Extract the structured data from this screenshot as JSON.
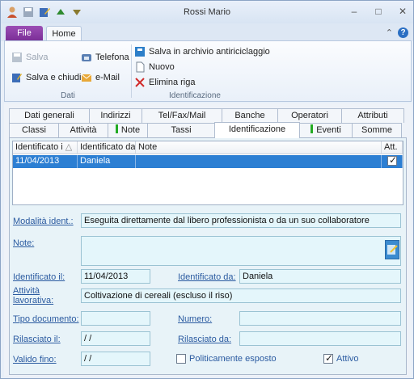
{
  "window": {
    "title": "Rossi Mario"
  },
  "ribbon_tabs": {
    "file": "File",
    "home": "Home"
  },
  "ribbon": {
    "dati": {
      "salva": "Salva",
      "salva_chiudi": "Salva e chiudi",
      "telefona": "Telefona",
      "email": "e-Mail",
      "label": "Dati"
    },
    "identificazione": {
      "salva_archivio": "Salva in archivio antiriciclaggio",
      "nuovo": "Nuovo",
      "elimina": "Elimina riga",
      "label": "Identificazione"
    }
  },
  "tabs": {
    "row1": [
      "Dati generali",
      "Indirizzi",
      "Tel/Fax/Mail",
      "Banche",
      "Operatori",
      "Attributi"
    ],
    "row2": [
      "Classi",
      "Attività",
      "Note",
      "Tassi",
      "Identificazione",
      "Eventi",
      "Somme"
    ]
  },
  "grid": {
    "headers": [
      "Identificato i",
      "Identificato da",
      "Note",
      "Att."
    ],
    "row": {
      "date": "11/04/2013",
      "by": "Daniela",
      "note": ""
    }
  },
  "form": {
    "modalita": {
      "label": "Modalità ident.:",
      "value": "Eseguita direttamente dal libero professionista o da un suo collaboratore"
    },
    "note": {
      "label": "Note:",
      "value": ""
    },
    "identificato_il": {
      "label": "Identificato il:",
      "value": "11/04/2013"
    },
    "identificato_da": {
      "label": "Identificato da:",
      "value": "Daniela"
    },
    "attivita": {
      "label": "Attività lavorativa:",
      "value": "Coltivazione di cereali (escluso il riso)"
    },
    "tipo_documento": {
      "label": "Tipo documento:",
      "value": ""
    },
    "numero": {
      "label": "Numero:",
      "value": ""
    },
    "rilasciato_il": {
      "label": "Rilasciato il:",
      "value": " /  /"
    },
    "rilasciato_da": {
      "label": "Rilasciato da:",
      "value": ""
    },
    "valido_fino": {
      "label": "Valido fino:",
      "value": " /  /"
    },
    "politicamente": {
      "label": "Politicamente esposto"
    },
    "attivo": {
      "label": "Attivo"
    }
  }
}
